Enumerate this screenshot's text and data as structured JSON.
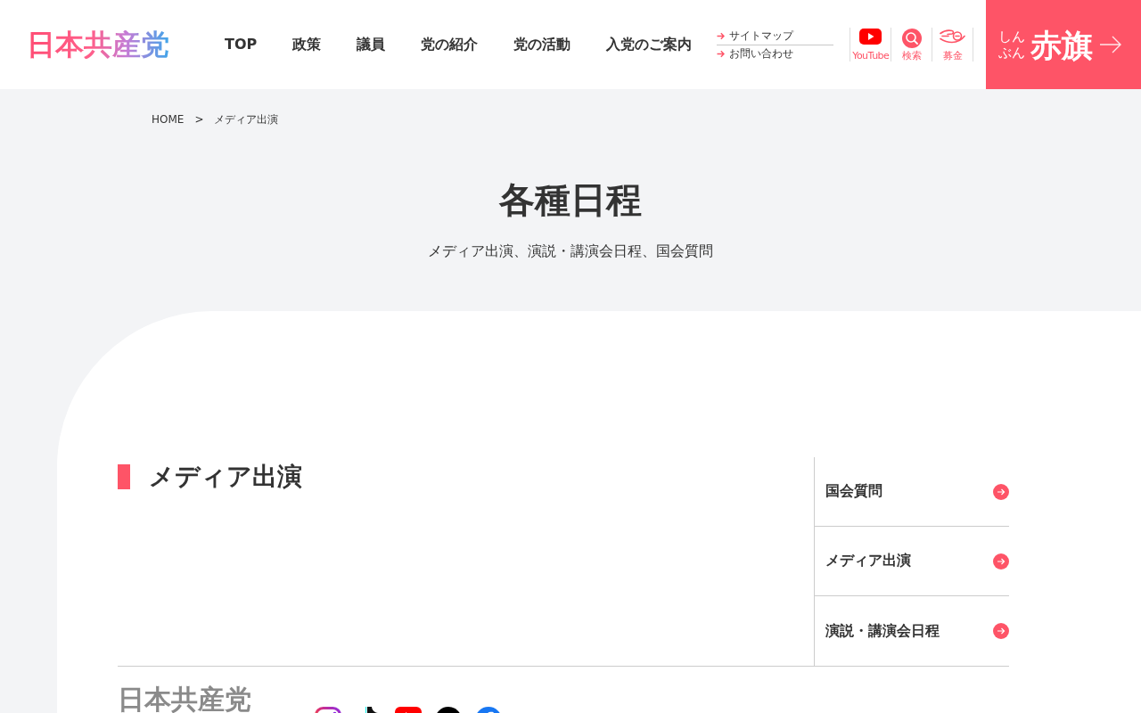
{
  "header": {
    "logo": "日本共産党",
    "nav": [
      {
        "label": "TOP"
      },
      {
        "label": "政策"
      },
      {
        "label": "議員"
      },
      {
        "label": "党の紹介"
      },
      {
        "label": "党の活動"
      },
      {
        "label": "入党のご案内"
      }
    ],
    "sub_links": [
      "サイトマップ",
      "お問い合わせ"
    ],
    "icon_links": [
      {
        "kind": "youtube",
        "label": "YouTube"
      },
      {
        "kind": "search",
        "label": "検索"
      },
      {
        "kind": "donate",
        "label": "募金"
      }
    ],
    "banner": {
      "kana": [
        "しん",
        "ぶん"
      ],
      "title": "赤旗"
    }
  },
  "breadcrumb": {
    "home": "HOME",
    "separator": ">",
    "current": "メディア出演"
  },
  "page_title": "各種日程",
  "page_subtitle": "メディア出演、演説・講演会日程、国会質問",
  "section": {
    "heading": "メディア出演"
  },
  "side_menu": [
    "国会質問",
    "メディア出演",
    "演説・講演会日程"
  ],
  "footer": {
    "logo": "日本共産党",
    "social": [
      {
        "kind": "instagram"
      },
      {
        "kind": "tiktok"
      },
      {
        "kind": "youtube"
      },
      {
        "kind": "x"
      },
      {
        "kind": "facebook"
      }
    ]
  }
}
